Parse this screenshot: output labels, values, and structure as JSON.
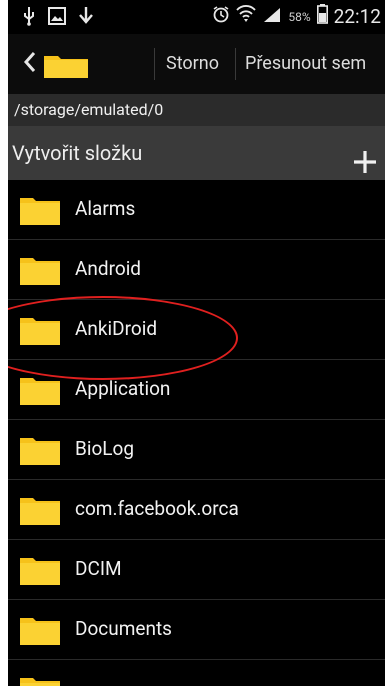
{
  "status_bar": {
    "icons_left": [
      "usb-icon",
      "image-icon",
      "download-icon"
    ],
    "icons_right": [
      "alarm-icon",
      "wifi-icon",
      "signal-icon",
      "battery-icon"
    ],
    "battery_percent": "58%",
    "time": "22:12"
  },
  "action_bar": {
    "cancel_label": "Storno",
    "move_label": "Přesunout sem"
  },
  "path": "/storage/emulated/0",
  "create_folder": {
    "label": "Vytvořit složku"
  },
  "folders": [
    {
      "name": "Alarms"
    },
    {
      "name": "Android"
    },
    {
      "name": "AnkiDroid"
    },
    {
      "name": "Application"
    },
    {
      "name": "BioLog"
    },
    {
      "name": "com.facebook.orca"
    },
    {
      "name": "DCIM"
    },
    {
      "name": "Documents"
    },
    {
      "name": ""
    }
  ],
  "colors": {
    "folder": "#f6c21a",
    "annotation": "#e0201f"
  }
}
